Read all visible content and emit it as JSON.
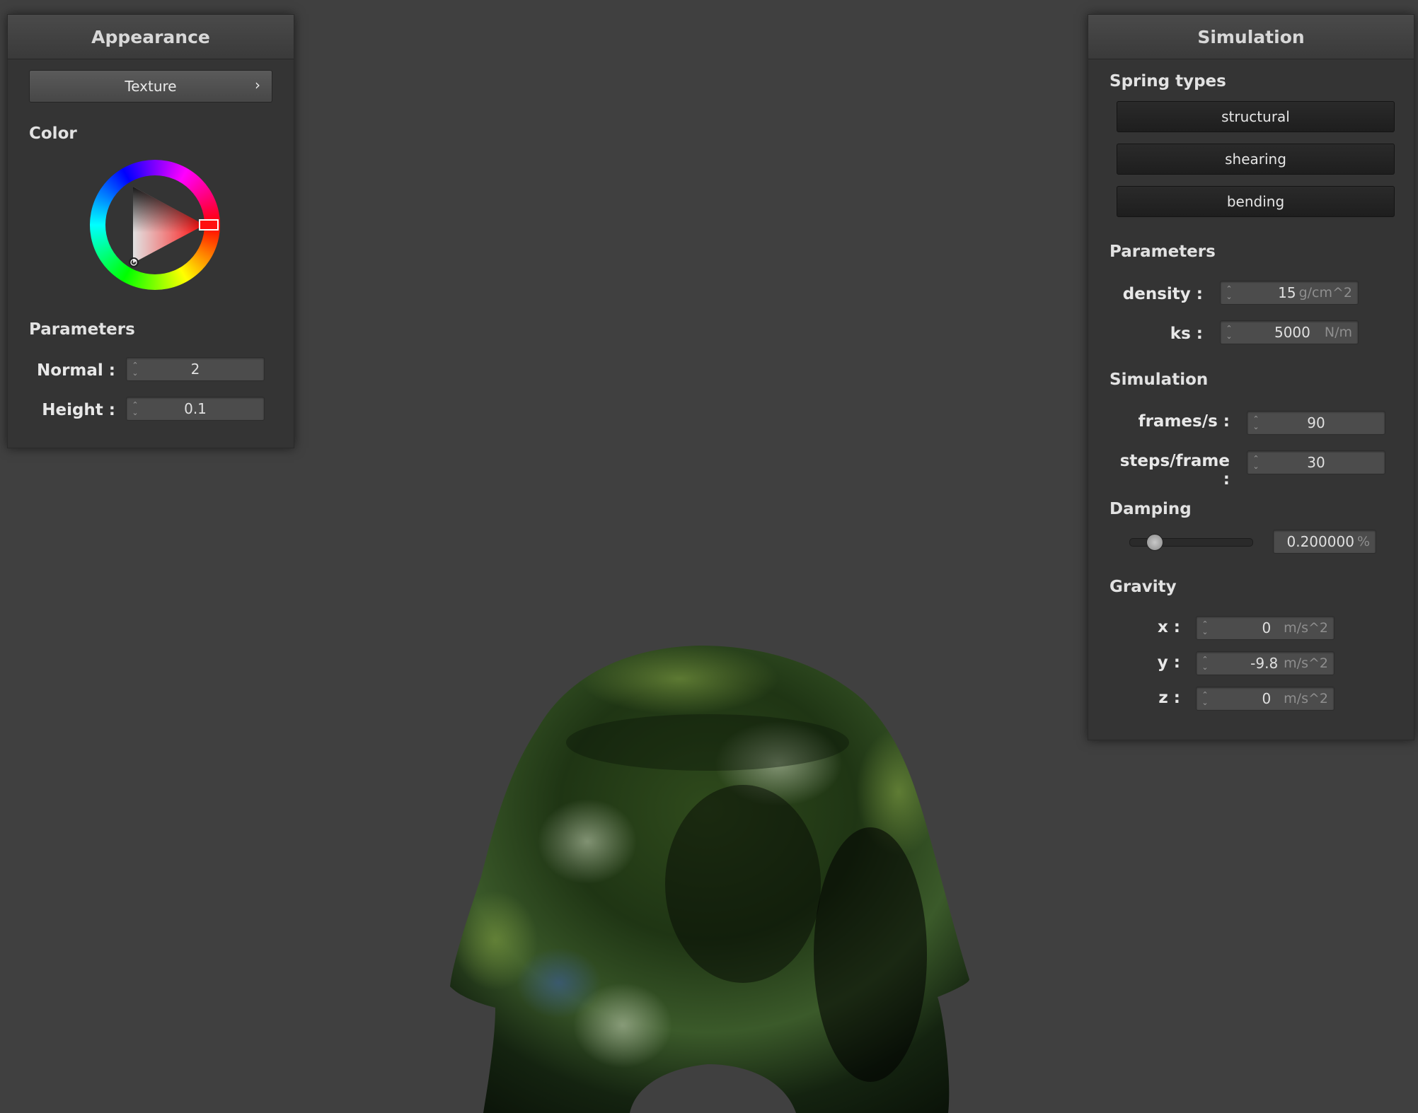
{
  "colors": {
    "background": "#404040",
    "panel": "#343434",
    "hue_selected": "#ff0000"
  },
  "appearance": {
    "title": "Appearance",
    "texture_button": "Texture",
    "texture_chevron": "›",
    "color_label": "Color",
    "params_label": "Parameters",
    "normal_label": "Normal :",
    "normal_value": "2",
    "height_label": "Height :",
    "height_value": "0.1"
  },
  "simulation": {
    "title": "Simulation",
    "spring_label": "Spring types",
    "springs": [
      "structural",
      "shearing",
      "bending"
    ],
    "params_label": "Parameters",
    "density_label": "density :",
    "density_value": "15",
    "density_unit": "g/cm^2",
    "ks_label": "ks :",
    "ks_value": "5000",
    "ks_unit": "N/m",
    "sim_label": "Simulation",
    "fps_label": "frames/s :",
    "fps_value": "90",
    "steps_label": "steps/frame :",
    "steps_value": "30",
    "damping_label": "Damping",
    "damping_value": "0.200000",
    "damping_unit": "%",
    "damping_slider_fraction": 0.2,
    "gravity_label": "Gravity",
    "gx_label": "x :",
    "gx_value": "0",
    "gy_label": "y :",
    "gy_value": "-9.8",
    "gz_label": "z :",
    "gz_value": "0",
    "gravity_unit": "m/s^2"
  }
}
